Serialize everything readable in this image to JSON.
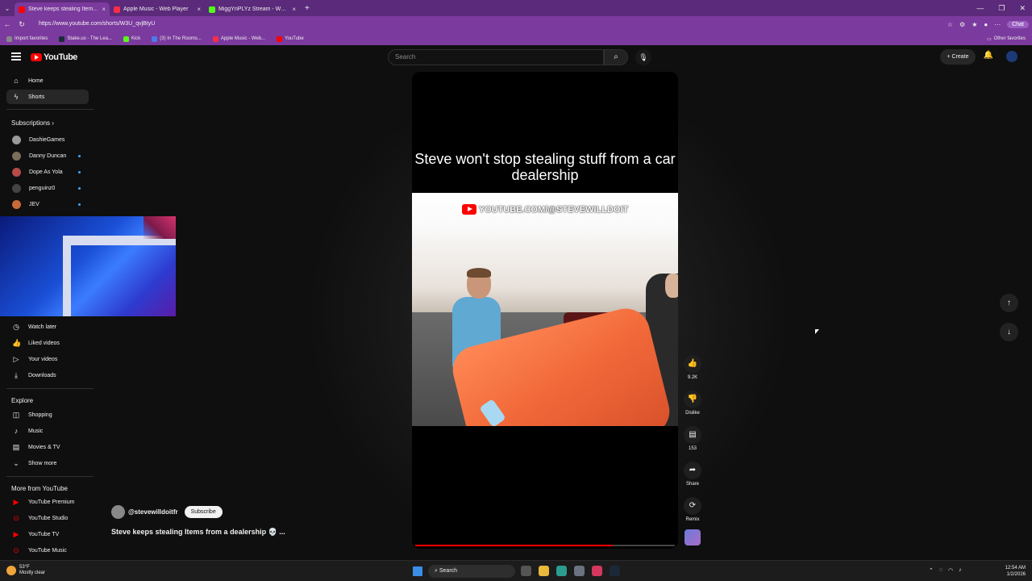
{
  "browser": {
    "tabs": [
      {
        "title": "Steve keeps stealing Items fr",
        "color": "#ff0000",
        "active": true
      },
      {
        "title": "Apple Music - Web Player",
        "color": "#fa2d48",
        "active": false
      },
      {
        "title": "MiggYnPLYz Stream - Watch",
        "color": "#53fc18",
        "active": false
      }
    ],
    "url": "https://www.youtube.com/shorts/W3U_qvjBtyU",
    "chat_label": "Chat",
    "bookmarks": [
      {
        "label": "Import favorites",
        "color": "#888888"
      },
      {
        "label": "Stake.us - The Lea...",
        "color": "#1a2c38"
      },
      {
        "label": "Kick",
        "color": "#53fc18"
      },
      {
        "label": "(3) In The Rooms...",
        "color": "#4b7bec"
      },
      {
        "label": "Apple Music - Web...",
        "color": "#fa2d48"
      },
      {
        "label": "YouTube",
        "color": "#ff0000"
      }
    ],
    "other_favorites": "Other favorites"
  },
  "header": {
    "logo_text": "YouTube",
    "search_placeholder": "Search",
    "create_label": "Create"
  },
  "sidebar": {
    "main": [
      {
        "label": "Home",
        "icon": "home-icon"
      },
      {
        "label": "Shorts",
        "icon": "shorts-icon",
        "active": true
      }
    ],
    "subscriptions_title": "Subscriptions",
    "subscriptions": [
      {
        "label": "DashieGames",
        "color": "#9a9a9a",
        "live": false
      },
      {
        "label": "Danny Duncan",
        "color": "#7a6d5c",
        "live": true
      },
      {
        "label": "Dope As Yola",
        "color": "#b84a4a",
        "live": true
      },
      {
        "label": "penguinz0",
        "color": "#444444",
        "live": true
      },
      {
        "label": "JEV",
        "color": "#c96a3a",
        "live": true
      }
    ],
    "you": [
      {
        "label": "Watch later",
        "icon": "clock-icon"
      },
      {
        "label": "Liked videos",
        "icon": "thumbs-up-icon"
      },
      {
        "label": "Your videos",
        "icon": "video-icon"
      },
      {
        "label": "Downloads",
        "icon": "download-icon"
      }
    ],
    "explore_title": "Explore",
    "explore": [
      {
        "label": "Shopping",
        "icon": "shopping-bag-icon"
      },
      {
        "label": "Music",
        "icon": "music-note-icon"
      },
      {
        "label": "Movies & TV",
        "icon": "film-icon"
      },
      {
        "label": "Show more",
        "icon": "chevron-down-icon"
      }
    ],
    "more_title": "More from YouTube",
    "more": [
      {
        "label": "YouTube Premium"
      },
      {
        "label": "YouTube Studio"
      },
      {
        "label": "YouTube TV"
      },
      {
        "label": "YouTube Music"
      }
    ]
  },
  "short": {
    "caption": "Steve won't stop stealing stuff from a car dealership",
    "channel_overlay": "YOUTUBE.COM/@STEVEWILLDOIT",
    "channel_handle": "@stevewilldoitfr",
    "subscribe_label": "Subscribe",
    "title": "Steve keeps stealing Items from a dealership 💀 ...",
    "progress": 0.76
  },
  "actions": {
    "likes": "9.2K",
    "dislike": "Dislike",
    "comments": "153",
    "share": "Share",
    "remix": "Remix"
  },
  "taskbar": {
    "temp": "53°F",
    "weather": "Mostly clear",
    "search": "Search",
    "time": "12:54 AM",
    "date": "1/2/2026"
  }
}
